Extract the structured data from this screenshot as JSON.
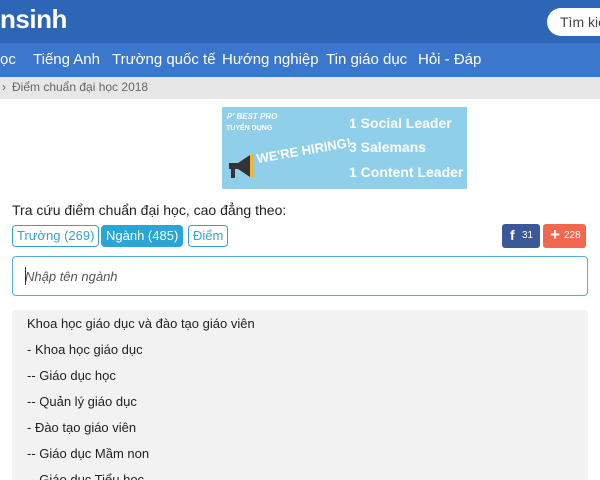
{
  "header": {
    "logo": "nsinh",
    "search_label": "Tìm kiế"
  },
  "nav": {
    "items": [
      "ọc",
      "Tiếng Anh",
      "Trường quốc tế",
      "Hướng nghiệp",
      "Tin giáo dục",
      "Hỏi - Đáp"
    ]
  },
  "breadcrumb": {
    "separator": "›",
    "current": "Điểm chuẩn đại học 2018"
  },
  "banner": {
    "brand": "P' BEST PRO",
    "subtitle": "TUYỂN DỤNG",
    "hiring": "WE'RE HIRING!",
    "lines": [
      "1 Social Leader",
      "3 Salemans",
      "1 Content Leader"
    ]
  },
  "lookup": {
    "title": "Tra cứu điểm chuẩn đại học, cao đẳng theo:",
    "tabs": [
      "Trường (269)",
      "Ngành (485)",
      "Điểm"
    ],
    "active_tab": "Ngành (485)"
  },
  "share": {
    "facebook_icon": "f",
    "facebook_count": "31",
    "plus_icon": "+",
    "plus_count": "228"
  },
  "search": {
    "placeholder": "Nhập tên ngành"
  },
  "majors": [
    "Khoa học giáo dục và đào tạo giáo viên",
    "- Khoa học giáo dục",
    "-- Giáo dục học",
    "-- Quản lý giáo dục",
    "- Đào tạo giáo viên",
    "-- Giáo dục Mầm non",
    "-- Giáo dục Tiểu học"
  ],
  "colors": {
    "header_bg": "#2e66b7",
    "nav_bg": "#3b77cc",
    "accent": "#29a5d6",
    "facebook": "#3b5998",
    "plus": "#f2684f"
  }
}
